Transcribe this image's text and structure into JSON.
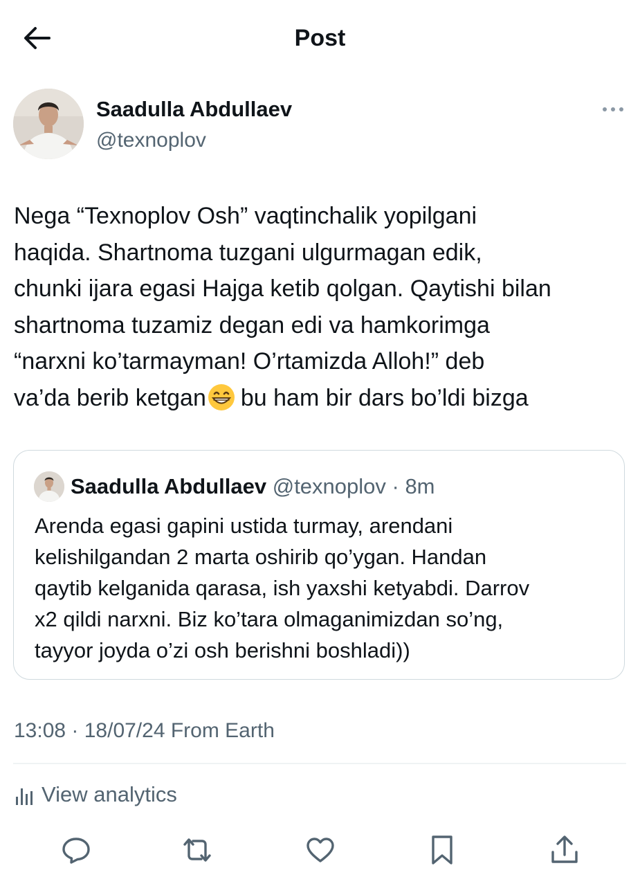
{
  "header": {
    "title": "Post"
  },
  "author": {
    "name": "Saadulla Abdullaev",
    "handle": "@texnoplov"
  },
  "tweet": {
    "lines": [
      "Nega “Texnoplov Osh” vaqtinchalik yopilgani",
      "haqida. Shartnoma tuzgani ulgurmagan edik,",
      "chunki ijara egasi Hajga ketib qolgan. Qaytishi bilan",
      "shartnoma tuzamiz degan edi va hamkorimga",
      "“narxni ko’tarmayman! O’rtamizda Alloh!” deb"
    ],
    "last_line_before_emoji": "va’da berib ketgan",
    "last_line_after_emoji": "bu ham bir dars bo’ldi bizga",
    "emoji": "grinning-face-with-smiling-eyes"
  },
  "quote": {
    "name": "Saadulla Abdullaev",
    "meta": " @texnoplov · 8m",
    "lines": [
      "Arenda egasi gapini ustida turmay, arendani",
      "kelishilgandan 2 marta oshirib qo’ygan. Handan",
      "qaytib kelganida qarasa, ish yaxshi ketyabdi. Darrov",
      "x2 qildi narxni. Biz ko’tara olmaganimizdan so’ng,",
      "tayyor joyda o’zi osh berishni boshladi))"
    ]
  },
  "timestamp": "13:08 · 18/07/24 From Earth",
  "analytics": {
    "label": "View analytics"
  },
  "actions": [
    "reply-icon",
    "repost-icon",
    "like-icon",
    "bookmark-icon",
    "share-icon"
  ],
  "colors": {
    "text": "#0f1419",
    "secondary": "#536471",
    "border": "#cfd9de"
  }
}
